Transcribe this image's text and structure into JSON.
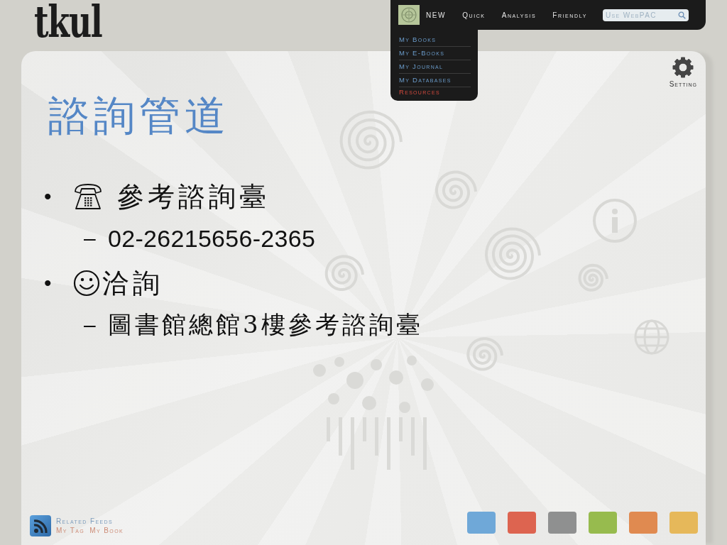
{
  "logo": {
    "text": "tkul"
  },
  "nav": {
    "items": [
      {
        "label": "NEW"
      },
      {
        "label": "Quick"
      },
      {
        "label": "Analysis"
      },
      {
        "label": "Friendly"
      }
    ],
    "search": {
      "placeholder": "Use WebPAC"
    },
    "menu": [
      {
        "label": "My Books",
        "selected": false
      },
      {
        "label": "My E-Books",
        "selected": false
      },
      {
        "label": "My Journal",
        "selected": false
      },
      {
        "label": "My Databases",
        "selected": false
      },
      {
        "label": "Resources",
        "selected": true
      }
    ]
  },
  "setting": {
    "label": "Setting"
  },
  "slide": {
    "title": "諮詢管道",
    "bullets": [
      {
        "marker": "•",
        "kind": "phone",
        "text": "參考諮詢臺",
        "children": [
          {
            "marker": "–",
            "text": "02-26215656-2365"
          }
        ]
      },
      {
        "marker": "•",
        "kind": "smiley",
        "text": "洽詢",
        "children": [
          {
            "marker": "–",
            "text": "圖書館總館3樓參考諮詢臺"
          }
        ]
      }
    ]
  },
  "footer": {
    "feeds": {
      "title": "Related Feeds",
      "links": [
        "My Tag",
        "My Book"
      ]
    },
    "swatches": [
      {
        "color": "#6fa8d8"
      },
      {
        "color": "#dd6450"
      },
      {
        "color": "#8f9090"
      },
      {
        "color": "#97bb4e"
      },
      {
        "color": "#e08a50"
      },
      {
        "color": "#e6b85a"
      }
    ]
  }
}
